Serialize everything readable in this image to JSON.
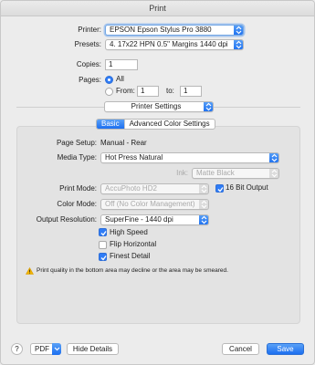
{
  "window": {
    "title": "Print"
  },
  "printer": {
    "label": "Printer:",
    "value": "EPSON Epson Stylus Pro 3880"
  },
  "presets": {
    "label": "Presets:",
    "value": "4. 17x22 HPN 0.5\" Margins 1440 dpi"
  },
  "copies": {
    "label": "Copies:",
    "value": "1"
  },
  "pages": {
    "label": "Pages:",
    "all_label": "All",
    "from_label": "From:",
    "from_value": "1",
    "to_label": "to:",
    "to_value": "1"
  },
  "section_popup": {
    "value": "Printer Settings"
  },
  "tabs": [
    {
      "label": "Basic",
      "active": true
    },
    {
      "label": "Advanced Color Settings",
      "active": false
    }
  ],
  "settings": {
    "page_setup_label": "Page Setup:",
    "page_setup_value": "Manual - Rear",
    "media_type_label": "Media Type:",
    "media_type_value": "Hot Press Natural",
    "ink_label": "Ink:",
    "ink_value": "Matte Black",
    "print_mode_label": "Print Mode:",
    "print_mode_value": "AccuPhoto HD2",
    "bit_output_label": "16 Bit Output",
    "color_mode_label": "Color Mode:",
    "color_mode_value": "Off (No Color Management)",
    "output_res_label": "Output Resolution:",
    "output_res_value": "SuperFine - 1440 dpi",
    "high_speed_label": "High Speed",
    "flip_label": "Flip Horizontal",
    "finest_label": "Finest Detail",
    "warning": "Print quality in the bottom area may decline or the area may be smeared."
  },
  "footer": {
    "help": "?",
    "pdf": "PDF",
    "hide_details": "Hide Details",
    "cancel": "Cancel",
    "save": "Save"
  },
  "colors": {
    "accent": "#2f7cf6",
    "warning": "#f2b400"
  }
}
